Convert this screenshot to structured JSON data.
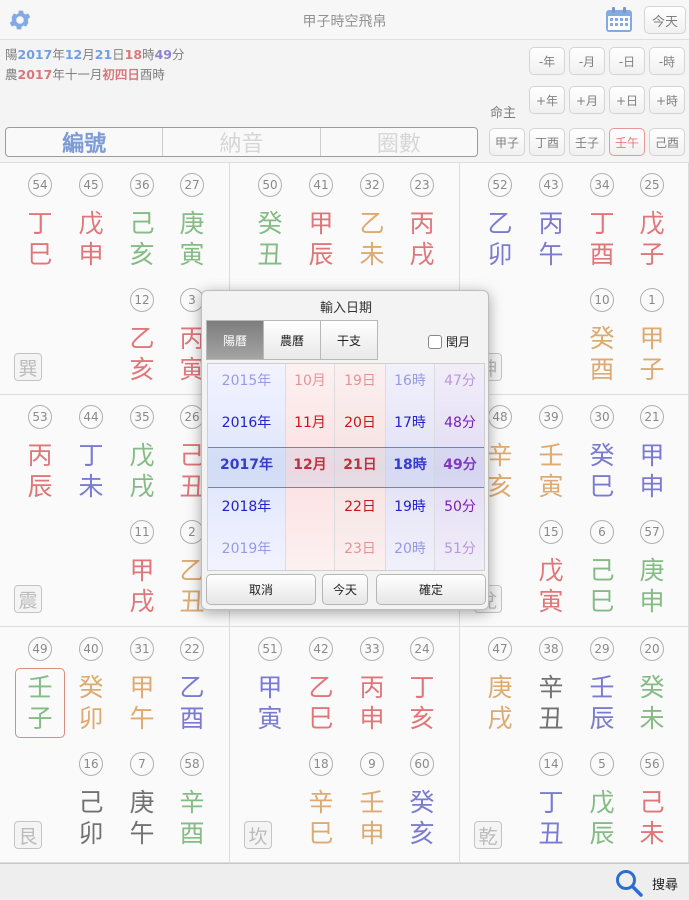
{
  "app": {
    "title": "甲子時空飛帛",
    "today_label": "今天"
  },
  "header": {
    "solar_prefix": "陽",
    "solar_year": "2017",
    "solar_year_unit": "年",
    "solar_month": "12",
    "solar_month_unit": "月",
    "solar_day": "21",
    "solar_day_unit": "日",
    "solar_hour": "18",
    "solar_hour_unit": "時",
    "solar_min": "49",
    "solar_min_unit": "分",
    "lunar_prefix": "農",
    "lunar_year": "2017",
    "lunar_mid": "年十一月",
    "lunar_day": "初四日",
    "lunar_hour": "酉時",
    "minus_labels": [
      "-年",
      "-月",
      "-日",
      "-時"
    ],
    "plus_labels": [
      "+年",
      "+月",
      "+日",
      "+時"
    ],
    "mingzhu_label": "命主",
    "pillars": [
      "甲子",
      "丁酉",
      "壬子",
      "壬午",
      "己酉"
    ],
    "segments": [
      "編號",
      "納音",
      "圈數"
    ],
    "active_segment": 0
  },
  "colors": {
    "wood": "#2e8a2e",
    "fire": "#c8151b",
    "earth": "#c46d0c",
    "metal": "#1b1bb0",
    "water": "#0b0b0b",
    "accent_blue": "#1f55b8",
    "selected_border": "#c0392b"
  },
  "grid": [
    {
      "gua": "巽",
      "items": [
        {
          "n": "54",
          "gz": "丁巳",
          "c": "fire"
        },
        {
          "n": "45",
          "gz": "戊申",
          "c": "fire"
        },
        {
          "n": "36",
          "gz": "己亥",
          "c": "wood"
        },
        {
          "n": "27",
          "gz": "庚寅",
          "c": "wood"
        },
        null,
        null,
        {
          "n": "12",
          "gz": "乙亥",
          "c": "fire"
        },
        {
          "n": "3",
          "gz": "丙寅",
          "c": "fire"
        }
      ]
    },
    {
      "gua": "",
      "items": [
        {
          "n": "50",
          "gz": "癸丑",
          "c": "wood"
        },
        {
          "n": "41",
          "gz": "甲辰",
          "c": "fire"
        },
        {
          "n": "32",
          "gz": "乙未",
          "c": "earth"
        },
        {
          "n": "23",
          "gz": "丙戌",
          "c": "fire"
        },
        null,
        null,
        null,
        null
      ]
    },
    {
      "gua": "坤",
      "items": [
        {
          "n": "52",
          "gz": "乙卯",
          "c": "metal"
        },
        {
          "n": "43",
          "gz": "丙午",
          "c": "metal"
        },
        {
          "n": "34",
          "gz": "丁酉",
          "c": "fire"
        },
        {
          "n": "25",
          "gz": "戊子",
          "c": "fire"
        },
        null,
        null,
        {
          "n": "10",
          "gz": "癸酉",
          "c": "earth"
        },
        {
          "n": "1",
          "gz": "甲子",
          "c": "earth"
        }
      ]
    },
    {
      "gua": "震",
      "items": [
        {
          "n": "53",
          "gz": "丙辰",
          "c": "fire"
        },
        {
          "n": "44",
          "gz": "丁未",
          "c": "metal"
        },
        {
          "n": "35",
          "gz": "戊戌",
          "c": "wood"
        },
        {
          "n": "26",
          "gz": "己丑",
          "c": "fire"
        },
        null,
        null,
        {
          "n": "11",
          "gz": "甲戌",
          "c": "fire"
        },
        {
          "n": "2",
          "gz": "乙丑",
          "c": "earth"
        }
      ]
    },
    {
      "gua": "",
      "items": [
        null,
        null,
        null,
        null,
        null,
        null,
        null,
        null
      ]
    },
    {
      "gua": "兌",
      "items": [
        {
          "n": "48",
          "gz": "辛亥",
          "c": "earth"
        },
        {
          "n": "39",
          "gz": "壬寅",
          "c": "earth"
        },
        {
          "n": "30",
          "gz": "癸巳",
          "c": "metal"
        },
        {
          "n": "21",
          "gz": "甲申",
          "c": "metal"
        },
        null,
        {
          "n": "15",
          "gz": "戊寅",
          "c": "fire"
        },
        {
          "n": "6",
          "gz": "己巳",
          "c": "wood"
        },
        {
          "n": "57",
          "gz": "庚申",
          "c": "wood"
        }
      ]
    },
    {
      "gua": "艮",
      "selected": 0,
      "items": [
        {
          "n": "49",
          "gz": "壬子",
          "c": "wood"
        },
        {
          "n": "40",
          "gz": "癸卯",
          "c": "earth"
        },
        {
          "n": "31",
          "gz": "甲午",
          "c": "earth"
        },
        {
          "n": "22",
          "gz": "乙酉",
          "c": "metal"
        },
        null,
        {
          "n": "16",
          "gz": "己卯",
          "c": "water"
        },
        {
          "n": "7",
          "gz": "庚午",
          "c": "water"
        },
        {
          "n": "58",
          "gz": "辛酉",
          "c": "wood"
        }
      ]
    },
    {
      "gua": "坎",
      "items": [
        {
          "n": "51",
          "gz": "甲寅",
          "c": "metal"
        },
        {
          "n": "42",
          "gz": "乙巳",
          "c": "fire"
        },
        {
          "n": "33",
          "gz": "丙申",
          "c": "fire"
        },
        {
          "n": "24",
          "gz": "丁亥",
          "c": "fire"
        },
        null,
        {
          "n": "18",
          "gz": "辛巳",
          "c": "earth"
        },
        {
          "n": "9",
          "gz": "壬申",
          "c": "earth"
        },
        {
          "n": "60",
          "gz": "癸亥",
          "c": "metal"
        }
      ]
    },
    {
      "gua": "乾",
      "items": [
        {
          "n": "47",
          "gz": "庚戌",
          "c": "earth"
        },
        {
          "n": "38",
          "gz": "辛丑",
          "c": "water"
        },
        {
          "n": "29",
          "gz": "壬辰",
          "c": "metal"
        },
        {
          "n": "20",
          "gz": "癸未",
          "c": "wood"
        },
        null,
        {
          "n": "14",
          "gz": "丁丑",
          "c": "metal"
        },
        {
          "n": "5",
          "gz": "戊辰",
          "c": "wood"
        },
        {
          "n": "56",
          "gz": "己未",
          "c": "fire"
        }
      ]
    }
  ],
  "dialog": {
    "title": "輸入日期",
    "tabs": [
      "陽曆",
      "農曆",
      "干支"
    ],
    "active_tab": 0,
    "leap_label": "閏月",
    "picker": {
      "columns": [
        {
          "items": [
            "2015年",
            "2016年",
            "2017年",
            "2018年",
            "2019年"
          ],
          "color": "#2222c8"
        },
        {
          "items": [
            "10月",
            "11月",
            "12月",
            "",
            ""
          ],
          "color": "#c8151b"
        },
        {
          "items": [
            "19日",
            "20日",
            "21日",
            "22日",
            "23日"
          ],
          "color": "#c8151b"
        },
        {
          "items": [
            "16時",
            "17時",
            "18時",
            "19時",
            "20時"
          ],
          "color": "#2222c8"
        },
        {
          "items": [
            "47分",
            "48分",
            "49分",
            "50分",
            "51分"
          ],
          "color": "#7a1fb8"
        }
      ]
    },
    "cancel_label": "取消",
    "today_label": "今天",
    "confirm_label": "確定"
  },
  "bottom": {
    "search_label": "搜尋"
  }
}
